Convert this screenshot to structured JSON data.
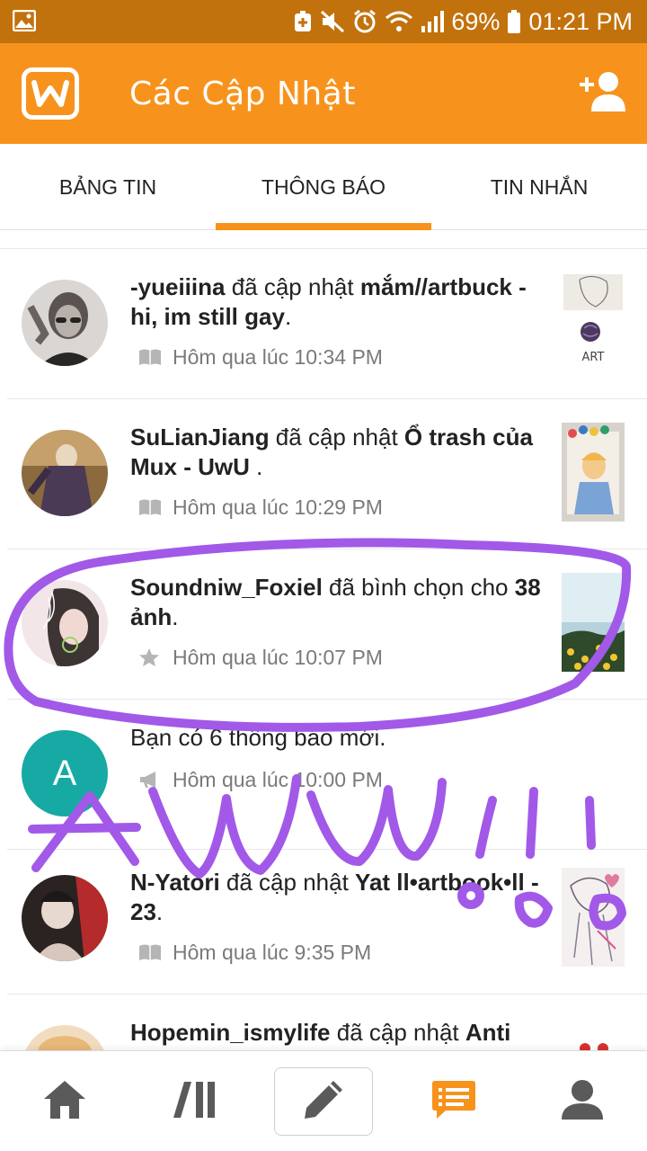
{
  "status_bar": {
    "battery_percent": "69%",
    "time": "01:21 PM"
  },
  "app_bar": {
    "title": "Các Cập Nhật",
    "logo_icon": "wattpad-logo-icon",
    "action_icon": "add-user-icon"
  },
  "tabs": [
    {
      "label": "BẢNG TIN",
      "active": false
    },
    {
      "label": "THÔNG BÁO",
      "active": true
    },
    {
      "label": "TIN NHẮN",
      "active": false
    }
  ],
  "notifications": [
    {
      "user": "-yueiiina",
      "action": " đã cập nhật ",
      "target": "mắm//artbuck - hi, im still gay",
      "suffix": ".",
      "time": "Hôm qua lúc 10:34 PM",
      "type_icon": "book-icon",
      "thumb_text": "ART"
    },
    {
      "user": "SuLianJiang",
      "action": " đã cập nhật ",
      "target": "Ổ trash của Mux - UwU",
      "suffix": " .",
      "time": "Hôm qua lúc 10:29 PM",
      "type_icon": "book-icon"
    },
    {
      "user": "Soundniw_Foxiel",
      "action": " đã bình chọn cho ",
      "target": "38 ảnh",
      "suffix": ".",
      "time": "Hôm qua lúc 10:07 PM",
      "type_icon": "star-icon"
    },
    {
      "user": "",
      "action": "Bạn có 6 thông báo mới.",
      "target": "",
      "suffix": "",
      "time": "Hôm qua lúc 10:00 PM",
      "type_icon": "megaphone-icon",
      "avatar_letter": "A"
    },
    {
      "user": "N-Yatori",
      "action": " đã cập nhật ",
      "target": "Yat ll•artbook•ll - 23",
      "suffix": ".",
      "time": "Hôm qua lúc 9:35 PM",
      "type_icon": "book-icon"
    },
    {
      "user": "Hopemin_ismylife",
      "action": " đã cập nhật ",
      "target": "Anti",
      "suffix": "",
      "time": "",
      "type_icon": "book-icon"
    }
  ],
  "bottom_nav": [
    "home-icon",
    "library-icon",
    "write-icon",
    "notifications-icon",
    "profile-icon"
  ],
  "colors": {
    "brand": "#f7931d",
    "status_bar": "#c2720c",
    "scribble": "#a259e8",
    "meta_text": "#7a7a7a"
  }
}
